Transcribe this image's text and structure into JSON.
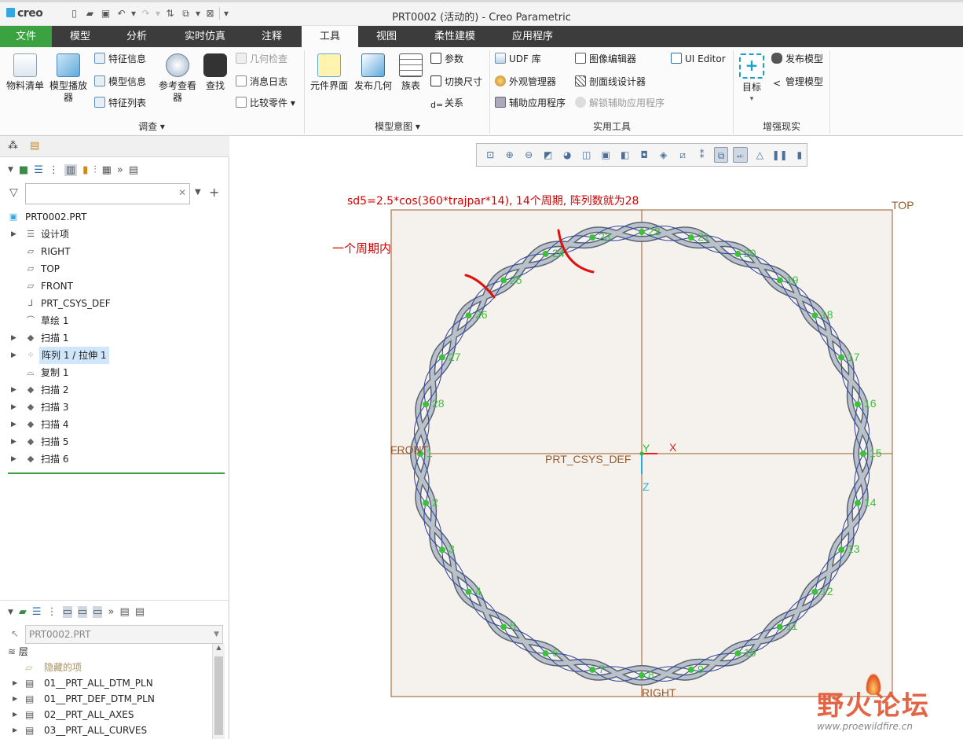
{
  "app": {
    "logo": "creo",
    "window_title": "PRT0002 (活动的) - Creo Parametric"
  },
  "tabs": [
    "文件",
    "模型",
    "分析",
    "实时仿真",
    "注释",
    "工具",
    "视图",
    "柔性建模",
    "应用程序"
  ],
  "active_tab": "工具",
  "ribbon": {
    "investigate": {
      "label": "调查",
      "bom": "物料清单",
      "model_player": "模型播放器",
      "feature_info": "特征信息",
      "model_info": "模型信息",
      "feature_list": "特征列表",
      "ref_viewer": "参考查看器",
      "find": "查找",
      "geom_check": "几何检查",
      "message_log": "消息日志",
      "compare_part": "比较零件"
    },
    "model_intent": {
      "label": "模型意图",
      "component_interface": "元件界面",
      "publish_geometry": "发布几何",
      "family_table": "族表",
      "params": "参数",
      "switch_dims": "切换尺寸",
      "relations": "关系"
    },
    "utilities": {
      "label": "实用工具",
      "udf_library": "UDF 库",
      "appearance_manager": "外观管理器",
      "aux_app": "辅助应用程序",
      "image_editor": "图像编辑器",
      "xsec_designer": "剖面线设计器",
      "unlock_aux": "解锁辅助应用程序",
      "ui_editor": "UI Editor"
    },
    "ar": {
      "label": "增强现实",
      "target": "目标",
      "publish_model": "发布模型",
      "manage_model": "管理模型"
    }
  },
  "model_tree": {
    "root": "PRT0002.PRT",
    "items": [
      {
        "label": "设计项",
        "expandable": true,
        "icon": "design-items-icon"
      },
      {
        "label": "RIGHT",
        "expandable": false,
        "icon": "datum-plane-icon"
      },
      {
        "label": "TOP",
        "expandable": false,
        "icon": "datum-plane-icon"
      },
      {
        "label": "FRONT",
        "expandable": false,
        "icon": "datum-plane-icon"
      },
      {
        "label": "PRT_CSYS_DEF",
        "expandable": false,
        "icon": "csys-icon"
      },
      {
        "label": "草绘 1",
        "expandable": false,
        "icon": "sketch-icon"
      },
      {
        "label": "扫描 1",
        "expandable": true,
        "icon": "sweep-icon"
      },
      {
        "label": "阵列 1 / 拉伸 1",
        "expandable": true,
        "icon": "pattern-icon",
        "selected": true
      },
      {
        "label": "复制 1",
        "expandable": false,
        "icon": "copy-icon"
      },
      {
        "label": "扫描 2",
        "expandable": true,
        "icon": "sweep-icon"
      },
      {
        "label": "扫描 3",
        "expandable": true,
        "icon": "sweep-icon"
      },
      {
        "label": "扫描 4",
        "expandable": true,
        "icon": "sweep-icon"
      },
      {
        "label": "扫描 5",
        "expandable": true,
        "icon": "sweep-icon"
      },
      {
        "label": "扫描 6",
        "expandable": true,
        "icon": "sweep-icon"
      }
    ]
  },
  "layer_tree": {
    "selector": "PRT0002.PRT",
    "header": "层",
    "items": [
      {
        "label": "隐藏的项",
        "dim": true
      },
      {
        "label": "01__PRT_ALL_DTM_PLN"
      },
      {
        "label": "01__PRT_DEF_DTM_PLN"
      },
      {
        "label": "02__PRT_ALL_AXES"
      },
      {
        "label": "03__PRT_ALL_CURVES"
      }
    ]
  },
  "viewport": {
    "note1": "sd5=2.5*cos(360*trajpar*14), 14个周期, 阵列数就为28",
    "note2": "一个周期内有两个阵列数",
    "plane_top": "TOP",
    "plane_front": "FRONT",
    "plane_right": "RIGHT",
    "csys": "PRT_CSYS_DEF",
    "axis_x": "X",
    "axis_y": "Y",
    "axis_z": "Z",
    "pattern_count": 28,
    "pattern_labels": [
      "1",
      "2",
      "3",
      "4",
      "5",
      "6",
      "7",
      "8",
      "9",
      "10",
      "11",
      "12",
      "13",
      "14",
      "15",
      "16",
      "17",
      "18",
      "19",
      "20",
      "21",
      "22",
      "23",
      "24",
      "25",
      "26",
      "27",
      "28"
    ]
  },
  "watermark": {
    "title": "野火论坛",
    "url": "www.proewildfire.cn"
  },
  "colors": {
    "file_tab": "#3aa240",
    "tab_bar": "#3c3c3c",
    "annotation": "#d40000",
    "pattern_points": "#3fbf3f",
    "datum_plane": "#9a5a2a"
  }
}
